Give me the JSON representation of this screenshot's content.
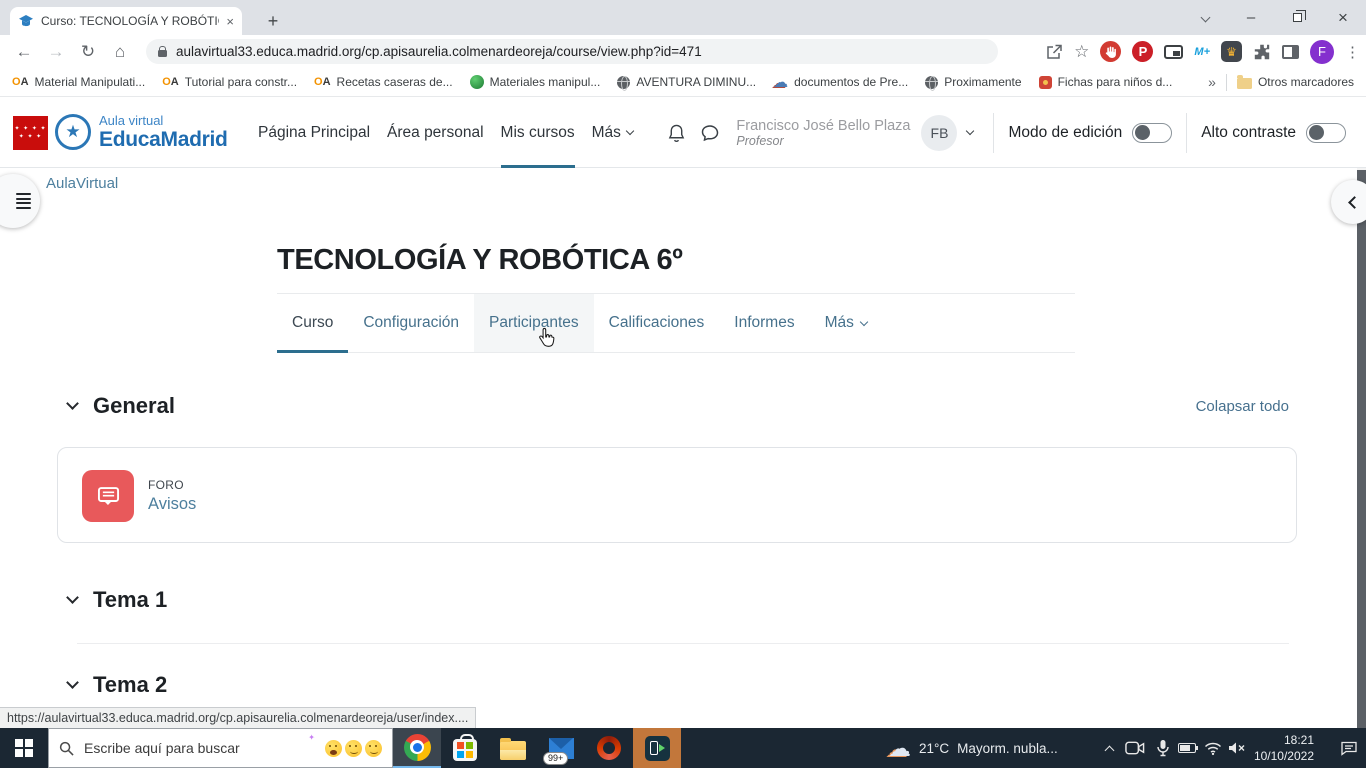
{
  "browser": {
    "tab_title": "Curso: TECNOLOGÍA Y ROBÓTIC",
    "url": "aulavirtual33.educa.madrid.org/cp.apisaurelia.colmenardeoreja/course/view.php?id=471",
    "bookmarks": [
      {
        "label": "Material Manipulati..."
      },
      {
        "label": "Tutorial para constr..."
      },
      {
        "label": "Recetas caseras de..."
      },
      {
        "label": "Materiales manipul..."
      },
      {
        "label": "AVENTURA DIMINU..."
      },
      {
        "label": "documentos de Pre..."
      },
      {
        "label": "Proximamente"
      },
      {
        "label": "Fichas para niños d..."
      }
    ],
    "overflow_glyph": "»",
    "other_bookmarks": "Otros marcadores"
  },
  "icons": {
    "oa": "OA",
    "pinterest_letter": "P",
    "mplus": "M+",
    "crown": "♛",
    "profile_letter": "F"
  },
  "header": {
    "brand_line1": "Aula virtual",
    "brand_line2": "EducaMadrid",
    "nav": [
      {
        "label": "Página Principal"
      },
      {
        "label": "Área personal"
      },
      {
        "label": "Mis cursos"
      },
      {
        "label": "Más"
      }
    ],
    "user_name": "Francisco José Bello Plaza",
    "user_role": "Profesor",
    "avatar_initials": "FB",
    "edit_mode_label": "Modo de edición",
    "contrast_label": "Alto contraste"
  },
  "page": {
    "breadcrumb": "AulaVirtual",
    "course_title": "TECNOLOGÍA Y ROBÓTICA 6º",
    "tabs": [
      {
        "label": "Curso"
      },
      {
        "label": "Configuración"
      },
      {
        "label": "Participantes"
      },
      {
        "label": "Calificaciones"
      },
      {
        "label": "Informes"
      },
      {
        "label": "Más"
      }
    ],
    "collapse_all": "Colapsar todo",
    "sections": [
      {
        "name": "General"
      },
      {
        "name": "Tema 1"
      },
      {
        "name": "Tema 2"
      }
    ],
    "activity_type": "FORO",
    "activity_name": "Avisos",
    "status_url": "https://aulavirtual33.educa.madrid.org/cp.apisaurelia.colmenardeoreja/user/index...."
  },
  "taskbar": {
    "search_placeholder": "Escribe aquí para buscar",
    "weather_temp": "21°C",
    "weather_condition": "Mayorm. nubla...",
    "mail_badge": "99+",
    "time": "18:21",
    "date": "10/10/2022"
  },
  "colors": {
    "accent": "#2c6e8e",
    "link": "#4d7f9e",
    "brand_blue": "#1f6cb0",
    "foro_red": "#e8595b"
  }
}
